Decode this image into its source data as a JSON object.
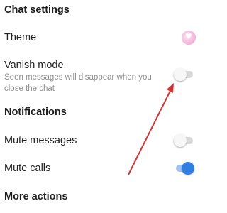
{
  "chat_settings": {
    "title": "Chat settings",
    "theme": {
      "label": "Theme"
    },
    "vanish_mode": {
      "label": "Vanish mode",
      "description": "Seen messages will disappear when you close the chat",
      "enabled": false
    }
  },
  "notifications": {
    "title": "Notifications",
    "mute_messages": {
      "label": "Mute messages",
      "enabled": false
    },
    "mute_calls": {
      "label": "Mute calls",
      "enabled": true
    }
  },
  "more_actions": {
    "title": "More actions"
  },
  "colors": {
    "toggle_on": "#2f7ee3",
    "toggle_off_track": "#d9d9d9",
    "annotation_arrow": "#d93030",
    "theme_swatch": "#f6b9de"
  },
  "icons": {
    "theme": "heart-icon"
  }
}
